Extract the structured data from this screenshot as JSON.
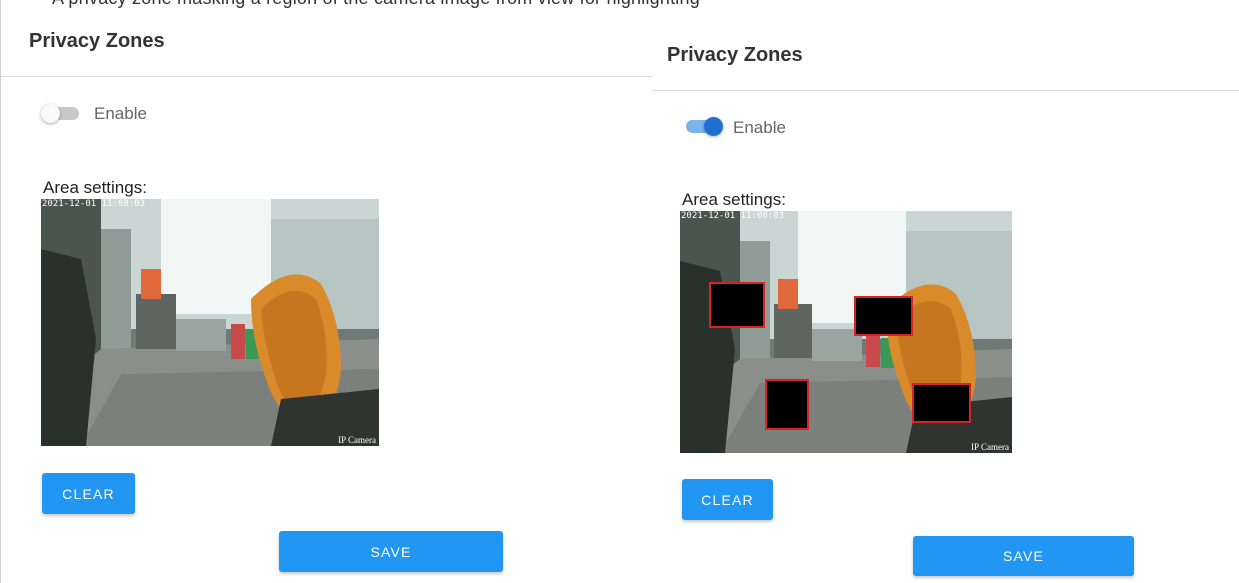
{
  "header_fragment": "A privacy zone masking a region of the camera image from view for highlighting",
  "left": {
    "title": "Privacy Zones",
    "enable_label": "Enable",
    "enabled": false,
    "area_label": "Area settings:",
    "timestamp": "2021-12-01 11:08:03",
    "watermark": "IP Camera",
    "clear_label": "CLEAR",
    "save_label": "SAVE"
  },
  "right": {
    "title": "Privacy Zones",
    "enable_label": "Enable",
    "enabled": true,
    "area_label": "Area settings:",
    "timestamp": "2021-12-01 11:08:03",
    "watermark": "IP Camera",
    "clear_label": "CLEAR",
    "save_label": "SAVE",
    "zone_count": 4
  },
  "colors": {
    "primary": "#2196f3",
    "toggle_on": "#1f6fd1",
    "zone_border": "#d8222a"
  }
}
